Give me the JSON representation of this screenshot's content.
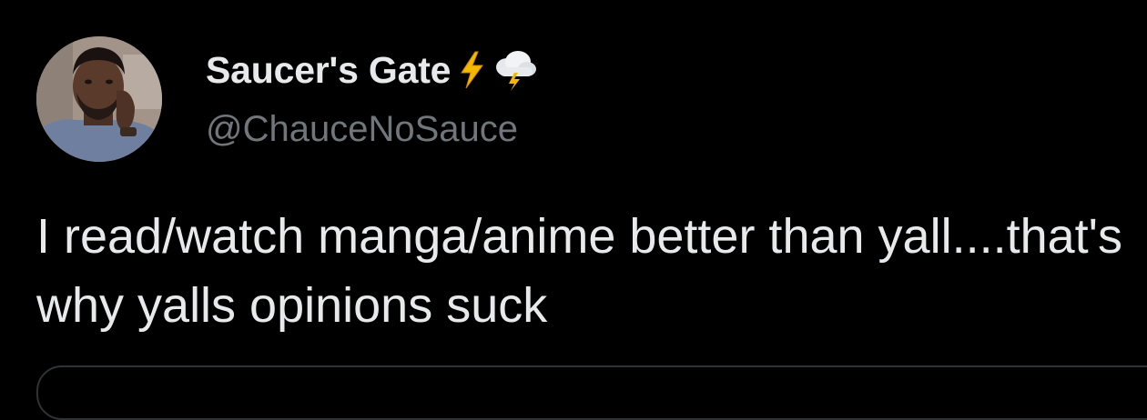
{
  "tweet": {
    "author": {
      "display_name": "Saucer's Gate",
      "handle": "@ChauceNoSauce",
      "badges": [
        "lightning-icon",
        "storm-cloud-icon"
      ]
    },
    "text": "I read/watch manga/anime better than yall....that's why yalls opinions suck"
  },
  "colors": {
    "background": "#000000",
    "primary_text": "#e7e9ea",
    "secondary_text": "#71767b",
    "lightning": "#f5b800",
    "border": "#2f3336"
  }
}
